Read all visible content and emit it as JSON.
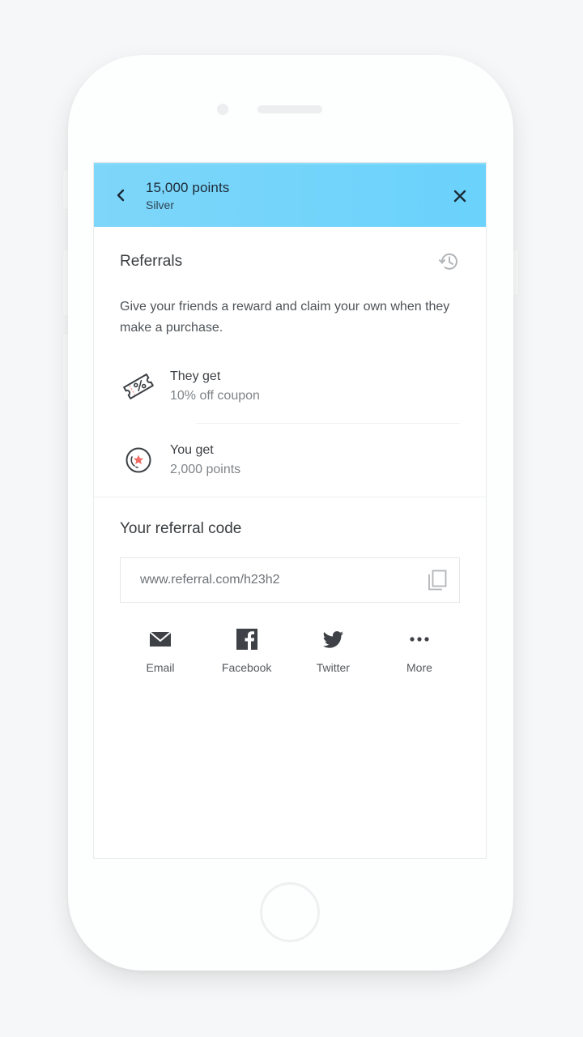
{
  "header": {
    "title": "15,000 points",
    "subtitle": "Silver",
    "back_icon": "chevron-left-icon",
    "close_icon": "close-icon",
    "color": "#74d4fb"
  },
  "referrals": {
    "title": "Referrals",
    "history_icon": "history-icon",
    "description": "Give your friends a reward and claim your own when they make a purchase.",
    "rewards": [
      {
        "icon": "coupon-icon",
        "label": "They get",
        "value": "10% off coupon"
      },
      {
        "icon": "points-coin-icon",
        "label": "You get",
        "value": "2,000 points"
      }
    ]
  },
  "referral_code": {
    "title": "Your referral code",
    "url": "www.referral.com/h23h2",
    "copy_icon": "copy-icon"
  },
  "share": [
    {
      "icon": "email-icon",
      "label": "Email"
    },
    {
      "icon": "facebook-icon",
      "label": "Facebook"
    },
    {
      "icon": "twitter-icon",
      "label": "Twitter"
    },
    {
      "icon": "more-icon",
      "label": "More"
    }
  ],
  "colors": {
    "accent": "#f06b64",
    "text_primary": "#3a3d40",
    "text_secondary": "#808488"
  }
}
